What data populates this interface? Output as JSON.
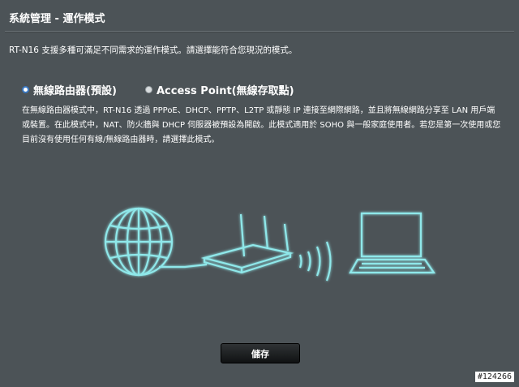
{
  "header": {
    "title": "系統管理 - 運作模式"
  },
  "intro_text": "RT-N16 支援多種可滿足不同需求的運作模式。請選擇能符合您現況的模式。",
  "modes": [
    {
      "label": "無線路由器(預設)",
      "selected": true
    },
    {
      "label": "Access Point(無線存取點)",
      "selected": false
    }
  ],
  "description": {
    "line1": "在無線路由器模式中，RT-N16 透過 PPPoE、DHCP、PPTP、L2TP 或靜態 IP 連接至網際網路，並且將無線網路分享至 LAN 用戶端",
    "line2": "或裝置。在此模式中，NAT、防火牆與 DHCP 伺服器被預設為開啟。此模式適用於 SOHO 與一般家庭使用者。若您是第一次使用或您",
    "line3": "目前沒有使用任何有線/無線路由器時，請選擇此模式。"
  },
  "illustration": {
    "icons": [
      "globe-icon",
      "router-icon",
      "wireless-signal-icon",
      "laptop-icon"
    ],
    "glow_color": "#8fe8ea"
  },
  "save_button": {
    "label": "儲存"
  },
  "watermark": "#124266",
  "colors": {
    "background": "#4c5357",
    "accent": "#8fe8ea",
    "button": "#17191a"
  }
}
